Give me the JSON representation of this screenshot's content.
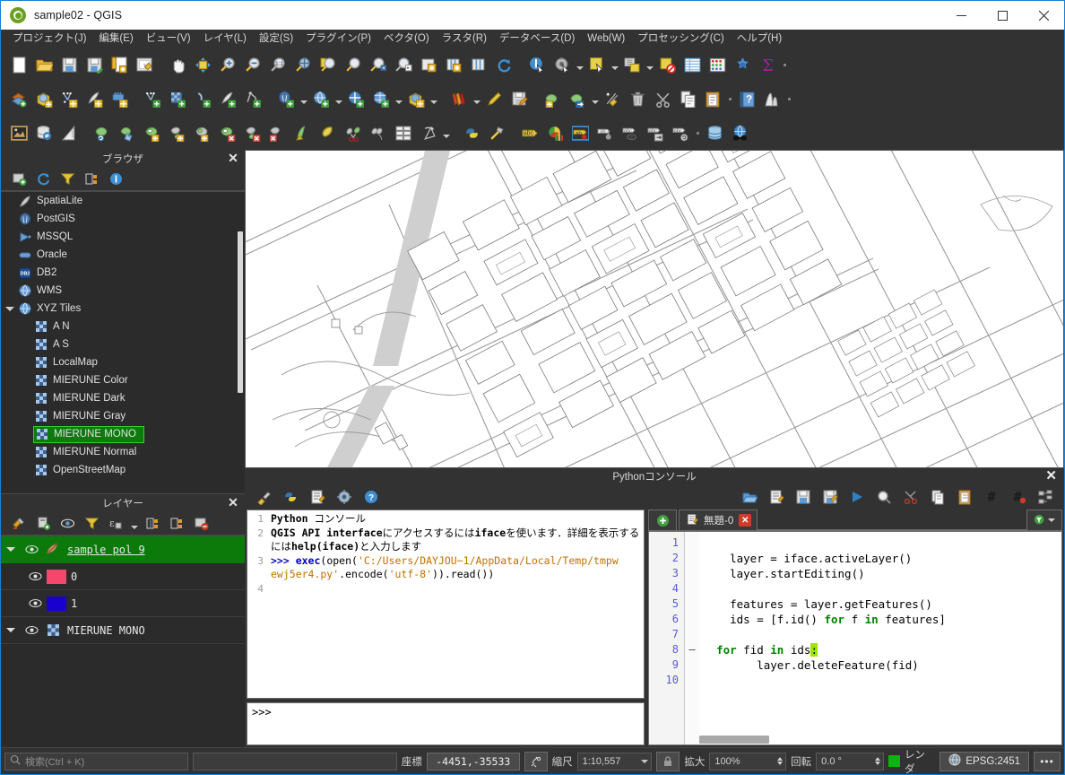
{
  "window": {
    "title": "sample02 - QGIS",
    "app_icon": "qgis-logo-icon",
    "minimize": "–",
    "maximize": "☐",
    "close": "✕"
  },
  "menubar": {
    "items": [
      {
        "label": "プロジェクト(J)",
        "name": "menu-project"
      },
      {
        "label": "編集(E)",
        "name": "menu-edit"
      },
      {
        "label": "ビュー(V)",
        "name": "menu-view"
      },
      {
        "label": "レイヤ(L)",
        "name": "menu-layer"
      },
      {
        "label": "設定(S)",
        "name": "menu-settings"
      },
      {
        "label": "プラグイン(P)",
        "name": "menu-plugins"
      },
      {
        "label": "ベクタ(O)",
        "name": "menu-vector"
      },
      {
        "label": "ラスタ(R)",
        "name": "menu-raster"
      },
      {
        "label": "データベース(D)",
        "name": "menu-database"
      },
      {
        "label": "Web(W)",
        "name": "menu-web"
      },
      {
        "label": "プロセッシング(C)",
        "name": "menu-processing"
      },
      {
        "label": "ヘルプ(H)",
        "name": "menu-help"
      }
    ]
  },
  "toolbars": {
    "row1": [
      "new-project-icon",
      "open-project-icon",
      "save-project-icon",
      "save-project-as-icon",
      "new-print-layout-icon",
      "layout-manager-icon",
      "SEP",
      "pan-map-icon",
      "pan-to-selection-icon",
      "zoom-in-icon",
      "zoom-out-icon",
      "zoom-full-icon",
      "zoom-native-icon",
      "zoom-to-selection-icon",
      "zoom-to-layer-icon",
      "zoom-last-icon",
      "zoom-next-icon",
      "new-map-view-icon",
      "new-3d-map-view-icon",
      "new-print-view-icon",
      "refresh-icon",
      "SEP",
      "identify-features-icon",
      "run-feature-action-icon",
      "CARET",
      "select-features-icon",
      "CARET",
      "select-by-value-icon",
      "CARET",
      "deselect-features-icon",
      "open-attribute-table-icon",
      "field-calculator-icon",
      "statistics-icon",
      "sum-icon",
      "DOT"
    ],
    "row2": [
      "add-layer-icon",
      "add-raster-layer-icon",
      "add-delimited-text-icon",
      "add-vector-tile-icon",
      "add-mesh-layer-icon",
      "SEP",
      "new-point-layer-icon",
      "new-shapefile-icon",
      "new-geopackage-icon",
      "new-spatialite-icon",
      "new-gpx-icon",
      "SEP",
      "add-postgis-layer-icon",
      "CARET",
      "add-wms-layer-icon",
      "CARET",
      "add-wcs-layer-icon",
      "add-wfs-layer-icon",
      "CARET",
      "add-arcgis-layer-icon",
      "CARET",
      "SEP",
      "open-styles-icon",
      "CARET",
      "edit-style-icon",
      "save-edits-icon",
      "SEP",
      "toggle-editing-icon",
      "move-feature-icon",
      "CARET",
      "vertex-tool-icon",
      "delete-selected-icon",
      "cut-features-icon",
      "copy-features-icon",
      "paste-features-icon",
      "DOT",
      "help-contents-icon",
      "histogram-icon",
      "DOT"
    ],
    "row3": [
      "georeferencer-icon",
      "db-manager-icon",
      "measure-line-icon",
      "SEP",
      "rotate-feature-icon",
      "simplify-feature-icon",
      "add-ring-icon",
      "add-part-icon",
      "fill-ring-icon",
      "delete-ring-icon",
      "delete-part-icon",
      "reshape-features-icon",
      "offset-curve-icon",
      "split-features-icon",
      "split-parts-icon",
      "merge-features-icon",
      "multi-edit-icon",
      "rotate-point-symbols-icon",
      "CARET",
      "SEP",
      "python-console-icon",
      "plugin-builder-icon",
      "SEP",
      "label-icon",
      "diagram-icon",
      "highlight-pinned-labels-icon",
      "pin-labels-icon",
      "show-hide-labels-icon",
      "move-label-icon",
      "rotate-label-icon",
      "DOT",
      "db-icon",
      "metasearch-icon"
    ]
  },
  "browser_panel": {
    "title": "ブラウザ",
    "close_label": "✕",
    "toolbar": [
      "add-layer-icon",
      "refresh-icon",
      "filter-icon",
      "collapse-all-icon",
      "properties-icon"
    ],
    "items": [
      {
        "label": "SpatiaLite",
        "icon": "spatialite-icon",
        "indent": 1,
        "expander": ""
      },
      {
        "label": "PostGIS",
        "icon": "postgis-icon",
        "indent": 1,
        "expander": ""
      },
      {
        "label": "MSSQL",
        "icon": "mssql-icon",
        "indent": 1,
        "expander": ""
      },
      {
        "label": "Oracle",
        "icon": "oracle-icon",
        "indent": 1,
        "expander": ""
      },
      {
        "label": "DB2",
        "icon": "db2-icon",
        "indent": 1,
        "expander": ""
      },
      {
        "label": "WMS",
        "icon": "wms-globe-icon",
        "indent": 1,
        "expander": ""
      },
      {
        "label": "XYZ Tiles",
        "icon": "xyz-globe-icon",
        "indent": 1,
        "expander": "open"
      },
      {
        "label": "A N",
        "icon": "tile-icon",
        "indent": 2,
        "expander": ""
      },
      {
        "label": "A S",
        "icon": "tile-icon",
        "indent": 2,
        "expander": ""
      },
      {
        "label": "LocalMap",
        "icon": "tile-icon",
        "indent": 2,
        "expander": ""
      },
      {
        "label": "MIERUNE Color",
        "icon": "tile-icon",
        "indent": 2,
        "expander": ""
      },
      {
        "label": "MIERUNE Dark",
        "icon": "tile-icon",
        "indent": 2,
        "expander": ""
      },
      {
        "label": "MIERUNE Gray",
        "icon": "tile-icon",
        "indent": 2,
        "expander": ""
      },
      {
        "label": "MIERUNE MONO",
        "icon": "tile-icon",
        "indent": 2,
        "expander": "",
        "selected": true
      },
      {
        "label": "MIERUNE Normal",
        "icon": "tile-icon",
        "indent": 2,
        "expander": ""
      },
      {
        "label": "OpenStreetMap",
        "icon": "tile-icon",
        "indent": 2,
        "expander": ""
      }
    ]
  },
  "layers_panel": {
    "title": "レイヤー",
    "close_label": "✕",
    "toolbar": [
      "open-layer-styling-icon",
      "add-group-icon",
      "manage-visibility-icon",
      "filter-legend-icon",
      "expression-filter-icon",
      "expand-all-icon",
      "collapse-all-icon",
      "remove-layer-icon"
    ],
    "rows": [
      {
        "name": "sample pol 9",
        "type": "layer",
        "selected": true,
        "icon": "vector-polygon-icon",
        "expander": true,
        "underline": true
      },
      {
        "name": "0",
        "type": "symbol",
        "swatch": "#f5476b",
        "indent": 1
      },
      {
        "name": "1",
        "type": "symbol",
        "swatch": "#1a00cf",
        "indent": 1
      },
      {
        "name": "MIERUNE MONO",
        "type": "layer",
        "icon": "tile-icon",
        "expander": true
      }
    ]
  },
  "map": {
    "name": "map-canvas",
    "basemap": "MIERUNE MONO"
  },
  "python_console": {
    "title": "Pythonコンソール",
    "close_label": "✕",
    "toolbar": [
      "clear-console-icon",
      "run-script-icon",
      "show-editor-icon",
      "options-icon",
      "help-icon"
    ],
    "editor_toolbar": [
      "open-script-icon",
      "new-script-icon",
      "save-script-icon",
      "save-as-script-icon",
      "run-script-icon",
      "find-text-icon",
      "cut-icon",
      "copy-icon",
      "paste-icon",
      "comment-icon",
      "uncomment-icon",
      "object-inspector-icon"
    ],
    "output_lines": [
      {
        "n": "1",
        "segments": [
          {
            "t": "Python ",
            "c": "bold"
          },
          {
            "t": "コンソール",
            "c": "plain"
          }
        ]
      },
      {
        "n": "2",
        "segments": [
          {
            "t": "QGIS API interface",
            "c": "bold"
          },
          {
            "t": "にアクセスするには",
            "c": "plain"
          },
          {
            "t": "iface",
            "c": "bold"
          },
          {
            "t": "を使います．詳細を表示する",
            "c": "plain"
          }
        ]
      },
      {
        "n": "",
        "segments": [
          {
            "t": "には",
            "c": "plain"
          },
          {
            "t": "help(iface)",
            "c": "bold"
          },
          {
            "t": "と入力します",
            "c": "plain"
          }
        ]
      },
      {
        "n": "3",
        "segments": [
          {
            "t": ">>> ",
            "c": "prompt"
          },
          {
            "t": "exec",
            "c": "blue"
          },
          {
            "t": "(open(",
            "c": "plain"
          },
          {
            "t": "'C:/Users/DAYJOU~1/AppData/Local/Temp/tmpw",
            "c": "str"
          }
        ]
      },
      {
        "n": "",
        "segments": [
          {
            "t": "ewj5er4.py'",
            "c": "str"
          },
          {
            "t": ".encode(",
            "c": "plain"
          },
          {
            "t": "'utf-8'",
            "c": "str"
          },
          {
            "t": ")).read())",
            "c": "plain"
          }
        ]
      },
      {
        "n": "4",
        "segments": [
          {
            "t": "",
            "c": "plain"
          }
        ]
      }
    ],
    "input_prompt": ">>>",
    "editor_tab": {
      "new_tab_label": "+",
      "tab_label": "無題-0",
      "tab_close": "✕",
      "tab_icon": "script-icon",
      "options_icon": "filter-dropdown-icon"
    },
    "code_lines": [
      {
        "n": "1",
        "fold": "",
        "segments": [
          {
            "t": "",
            "c": "plain"
          }
        ]
      },
      {
        "n": "2",
        "fold": "",
        "segments": [
          {
            "t": "    layer·=·iface.activeLayer()",
            "c": "plain"
          }
        ]
      },
      {
        "n": "3",
        "fold": "",
        "segments": [
          {
            "t": "    layer.startEditing()",
            "c": "plain"
          }
        ]
      },
      {
        "n": "4",
        "fold": "",
        "segments": [
          {
            "t": "",
            "c": "plain"
          }
        ]
      },
      {
        "n": "5",
        "fold": "",
        "segments": [
          {
            "t": "    features·=·layer.getFeatures()",
            "c": "plain"
          }
        ]
      },
      {
        "n": "6",
        "fold": "",
        "segments": [
          {
            "t": "    ids·=·[f.id()·",
            "c": "plain"
          },
          {
            "t": "for",
            "c": "kw"
          },
          {
            "t": "·f·",
            "c": "plain"
          },
          {
            "t": "in",
            "c": "kw"
          },
          {
            "t": "·features]",
            "c": "plain"
          }
        ]
      },
      {
        "n": "7",
        "fold": "",
        "segments": [
          {
            "t": "",
            "c": "plain"
          }
        ]
      },
      {
        "n": "8",
        "fold": "–",
        "segments": [
          {
            "t": "  ",
            "c": "plain"
          },
          {
            "t": "for",
            "c": "kw"
          },
          {
            "t": "·fid·",
            "c": "plain"
          },
          {
            "t": "in",
            "c": "kw"
          },
          {
            "t": "·ids",
            "c": "plain"
          },
          {
            "t": ":",
            "c": "sel"
          }
        ]
      },
      {
        "n": "9",
        "fold": "",
        "segments": [
          {
            "t": "        layer.deleteFeature(fid)",
            "c": "plain"
          }
        ]
      },
      {
        "n": "10",
        "fold": "",
        "segments": [
          {
            "t": "",
            "c": "plain"
          }
        ]
      }
    ]
  },
  "statusbar": {
    "search_placeholder": "検索(Ctrl + K)",
    "search_icon": "search-icon",
    "coordinate_label": "座標",
    "coordinate_value": "-4451,-35533",
    "coordinate_toggle_icon": "coordinate-capture-icon",
    "scale_label": "縮尺",
    "scale_value": "1:10,557",
    "scale_lock_icon": "lock-icon",
    "magnifier_label": "拡大",
    "magnifier_value": "100%",
    "rotation_label": "回転",
    "rotation_value": "0.0 °",
    "render_label": "レンダ",
    "render_color": "#0db40d",
    "crs_label": "EPSG:2451",
    "crs_icon": "globe-icon",
    "messages_icon": "messages-icon",
    "messages_label": "•••"
  }
}
